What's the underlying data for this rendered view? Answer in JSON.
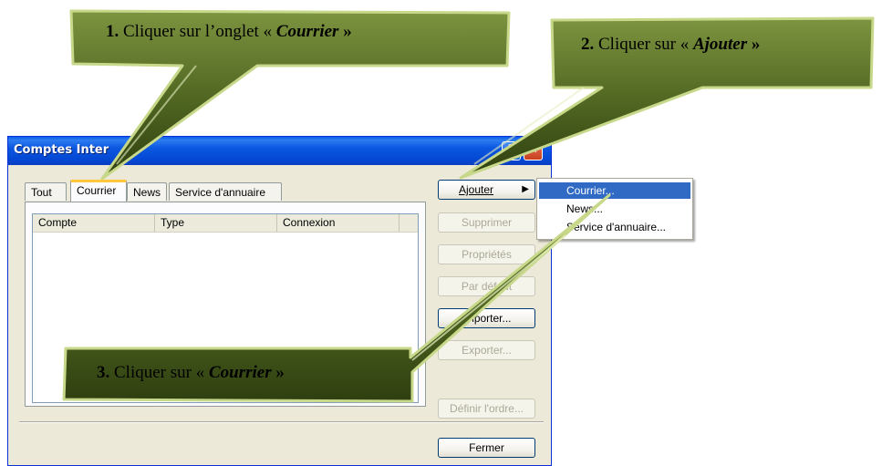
{
  "window": {
    "title": "Comptes Inter",
    "help_glyph": "?",
    "close_glyph": "✕"
  },
  "tabs": [
    "Tout",
    "Courrier",
    "News",
    "Service d'annuaire"
  ],
  "list": {
    "columns": [
      "Compte",
      "Type",
      "Connexion"
    ]
  },
  "buttons": {
    "ajouter": "Ajouter",
    "ajouter_arrow": "▶",
    "supprimer": "Supprimer",
    "proprietes": "Propriétés",
    "par_defaut": "Par défaut",
    "importer": "Importer...",
    "exporter": "Exporter...",
    "definir_ordre": "Définir l'ordre...",
    "fermer": "Fermer"
  },
  "submenu": {
    "items": [
      "Courrier...",
      "News...",
      "Service d'annuaire..."
    ]
  },
  "callouts": {
    "c1": {
      "number": "1.",
      "text": " Cliquer sur l’onglet « ",
      "target": "Courrier",
      "close": " »"
    },
    "c2": {
      "number": "2.",
      "text": " Cliquer sur « ",
      "target": "Ajouter",
      "close": " »"
    },
    "c3": {
      "number": "3.",
      "text": " Cliquer sur « ",
      "target": "Courrier",
      "close": " »"
    }
  },
  "colors": {
    "callout_fill": "#4e6420",
    "callout_dark": "#2f3f10",
    "callout_border": "#c8d88a",
    "titlebar": "#0b57e0",
    "menu_highlight": "#316ac5"
  }
}
